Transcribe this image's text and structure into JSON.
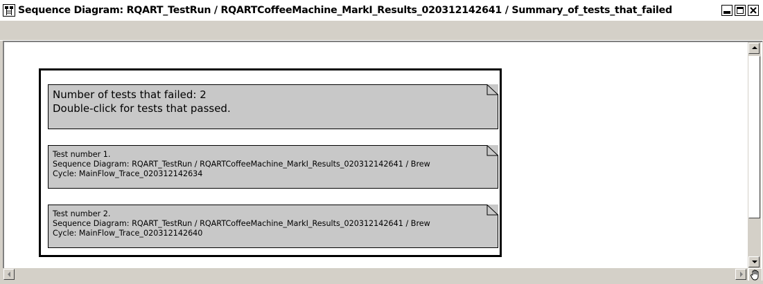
{
  "window": {
    "title": "Sequence Diagram: RQART_TestRun / RQARTCoffeeMachine_MarkI_Results_020312142641 / Summary_of_tests_that_failed",
    "icons": [
      "app-diagram-icon",
      "minimize-icon",
      "maximize-icon",
      "close-icon"
    ]
  },
  "diagram": {
    "summary": {
      "line1": "Number of tests that failed: 2",
      "line2": "Double-click for tests that passed."
    },
    "tests": [
      {
        "line1": "Test number 1.",
        "line2": "Sequence Diagram: RQART_TestRun / RQARTCoffeeMachine_MarkI_Results_020312142641 / Brew",
        "line3": "Cycle: MainFlow_Trace_020312142634"
      },
      {
        "line1": "Test number 2.",
        "line2": "Sequence Diagram: RQART_TestRun / RQARTCoffeeMachine_MarkI_Results_020312142641 / Brew",
        "line3": "Cycle: MainFlow_Trace_020312142640"
      }
    ]
  },
  "colors": {
    "note_fill": "#c8c8c8",
    "window_bg": "#d4d0c8",
    "canvas_bg": "#ffffff"
  }
}
